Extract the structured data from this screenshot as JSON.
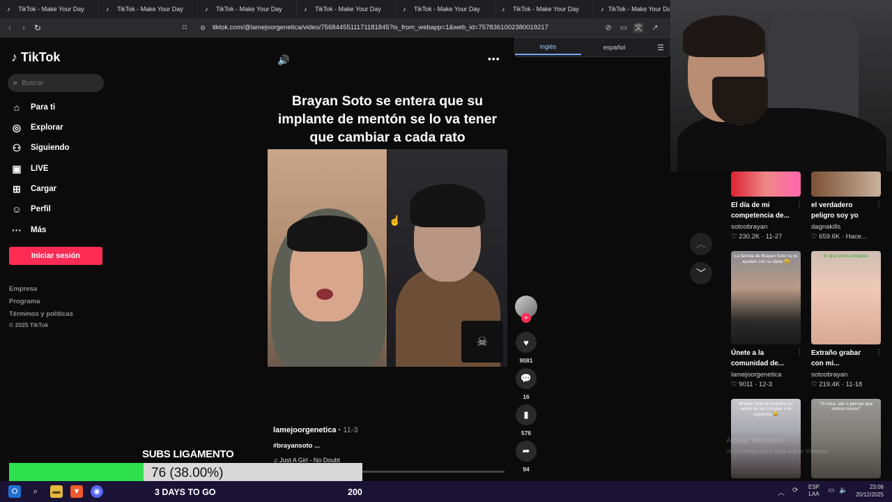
{
  "browser": {
    "tabs": [
      {
        "title": "TikTok - Make Your Day"
      },
      {
        "title": "TikTok - Make Your Day"
      },
      {
        "title": "TikTok - Make Your Day"
      },
      {
        "title": "TikTok - Make Your Day"
      },
      {
        "title": "TikTok - Make Your Day"
      },
      {
        "title": "TikTok - Make Your Day"
      },
      {
        "title": "TikTok - Make Your Day"
      }
    ],
    "url": "tiktok.com/@lamejoorgenetica/video/7568445511171181845?is_from_webapp=1&web_id=7578361002380019217",
    "translate": {
      "lang_active": "inglés",
      "lang_other": "español"
    }
  },
  "sidebar": {
    "logo": "TikTok",
    "search_placeholder": "Buscar",
    "items": [
      {
        "label": "Para ti",
        "icon": "home-icon"
      },
      {
        "label": "Explorar",
        "icon": "compass-icon"
      },
      {
        "label": "Siguiendo",
        "icon": "following-icon"
      },
      {
        "label": "LIVE",
        "icon": "live-icon"
      },
      {
        "label": "Cargar",
        "icon": "upload-icon"
      },
      {
        "label": "Perfil",
        "icon": "profile-icon"
      },
      {
        "label": "Más",
        "icon": "more-icon"
      }
    ],
    "login_label": "Iniciar sesión",
    "footer": [
      "Empresa",
      "Programa",
      "Términos y políticas",
      "© 2025 TikTok"
    ]
  },
  "video": {
    "title": "Brayan Soto se entera que su implante de mentón se lo va tener que cambiar a cada rato",
    "author": "lamejoorgenetica",
    "date": "11-3",
    "hashtag": "#brayansoto ...",
    "song": "Just A Girl - No Doubt",
    "progress": 0.2,
    "actions": {
      "likes": "9081",
      "comments": "16",
      "saves": "576",
      "shares": "94"
    }
  },
  "recommended": [
    {
      "title1": "El día de mi",
      "title2": "competencia de...",
      "user": "sotoobrayan",
      "likes": "230.2K",
      "date": "11-27"
    },
    {
      "title1": "el verdadero",
      "title2": "peligro soy yo",
      "user": "dagnakills",
      "likes": "659.6K",
      "date": "Hace..."
    },
    {
      "title1": "Únete a la",
      "title2": "comunidad de...",
      "user": "lamejoorgenetica",
      "likes": "9011",
      "date": "12-3",
      "caption": "La familia de Brayan Soto no le ayudan con su dieta 😩"
    },
    {
      "title1": "Extraño grabar",
      "title2": "con mi...",
      "user": "sotoobrayan",
      "likes": "219.4K",
      "date": "11-18",
      "caption": "El que todos olvidaron"
    },
    {
      "caption": "Brayan Soto le muestra su antes de las cirugías a la española 😂"
    },
    {
      "caption": "\"Si mira, van a pensar que somos novios\""
    }
  ],
  "overlay": {
    "subs_label": "SUBS LIGAMENTO",
    "subs_value": "76 (38.00%)",
    "subs_fraction": 0.38,
    "days": "3 DAYS TO GO",
    "goal": "200"
  },
  "watermark": {
    "line1": "Activar Windows",
    "line2": "Ve a Configuración para activar Windows."
  },
  "taskbar": {
    "lang1": "ESP",
    "lang2": "LAA",
    "time": "23:06",
    "date": "20/12/2025"
  }
}
